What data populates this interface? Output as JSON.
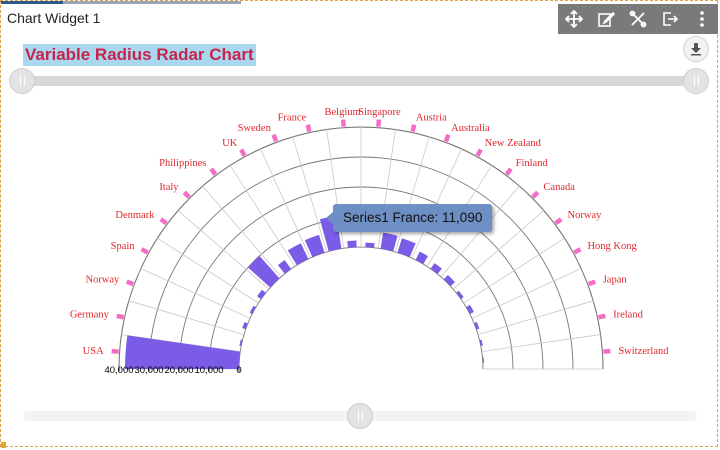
{
  "widget": {
    "title": "Chart Widget 1",
    "toolbar": [
      {
        "name": "move-icon",
        "glyph": "✥"
      },
      {
        "name": "edit-icon",
        "glyph": "✎"
      },
      {
        "name": "settings-tools-icon",
        "glyph": "✂"
      },
      {
        "name": "export-icon",
        "glyph": "⇥"
      },
      {
        "name": "more-options-icon",
        "glyph": "⋮"
      }
    ],
    "download_icon": "download-icon"
  },
  "tooltip": {
    "series": "Series1",
    "category": "France",
    "value": "11,090",
    "text": "Series1 France: 11,090"
  },
  "colors": {
    "bar": "#7b5ce6",
    "category_label": "#e0282e",
    "tick_marker": "#f56cc6",
    "title_text": "#c7254e",
    "title_bg": "#a9d7ee"
  },
  "chart_data": {
    "type": "bar",
    "subtype": "variable-radius-radar",
    "title": "Variable Radius Radar Chart",
    "start_angle_deg": 180,
    "end_angle_deg": 0,
    "y_axis": {
      "min": 0,
      "max": 40000,
      "ticks": [
        0,
        10000,
        20000,
        30000,
        40000
      ],
      "tick_labels": [
        "0",
        "10,000",
        "20,000",
        "30,000",
        "40,000"
      ]
    },
    "categories": [
      "USA",
      "Germany",
      "Norway",
      "Spain",
      "Denmark",
      "Italy",
      "Philippines",
      "UK",
      "Sweden",
      "France",
      "Belgium",
      "Singapore",
      "Austria",
      "Australia",
      "New Zealand",
      "Finland",
      "Canada",
      "Norway",
      "Hong Kong",
      "Japan",
      "Ireland",
      "Switzerland"
    ],
    "series": [
      {
        "name": "Series1",
        "values": [
          38000,
          600,
          1200,
          900,
          1600,
          10000,
          3700,
          5800,
          6200,
          11090,
          2200,
          1500,
          5400,
          5000,
          3100,
          2300,
          2000,
          1100,
          1500,
          1000,
          700,
          400
        ],
        "radius_factors": [
          1.0,
          0.35,
          0.35,
          0.45,
          0.45,
          0.75,
          0.45,
          0.75,
          0.75,
          0.75,
          0.5,
          0.5,
          0.75,
          0.75,
          0.5,
          0.5,
          0.55,
          0.45,
          0.45,
          0.4,
          0.35,
          0.3
        ]
      }
    ]
  }
}
